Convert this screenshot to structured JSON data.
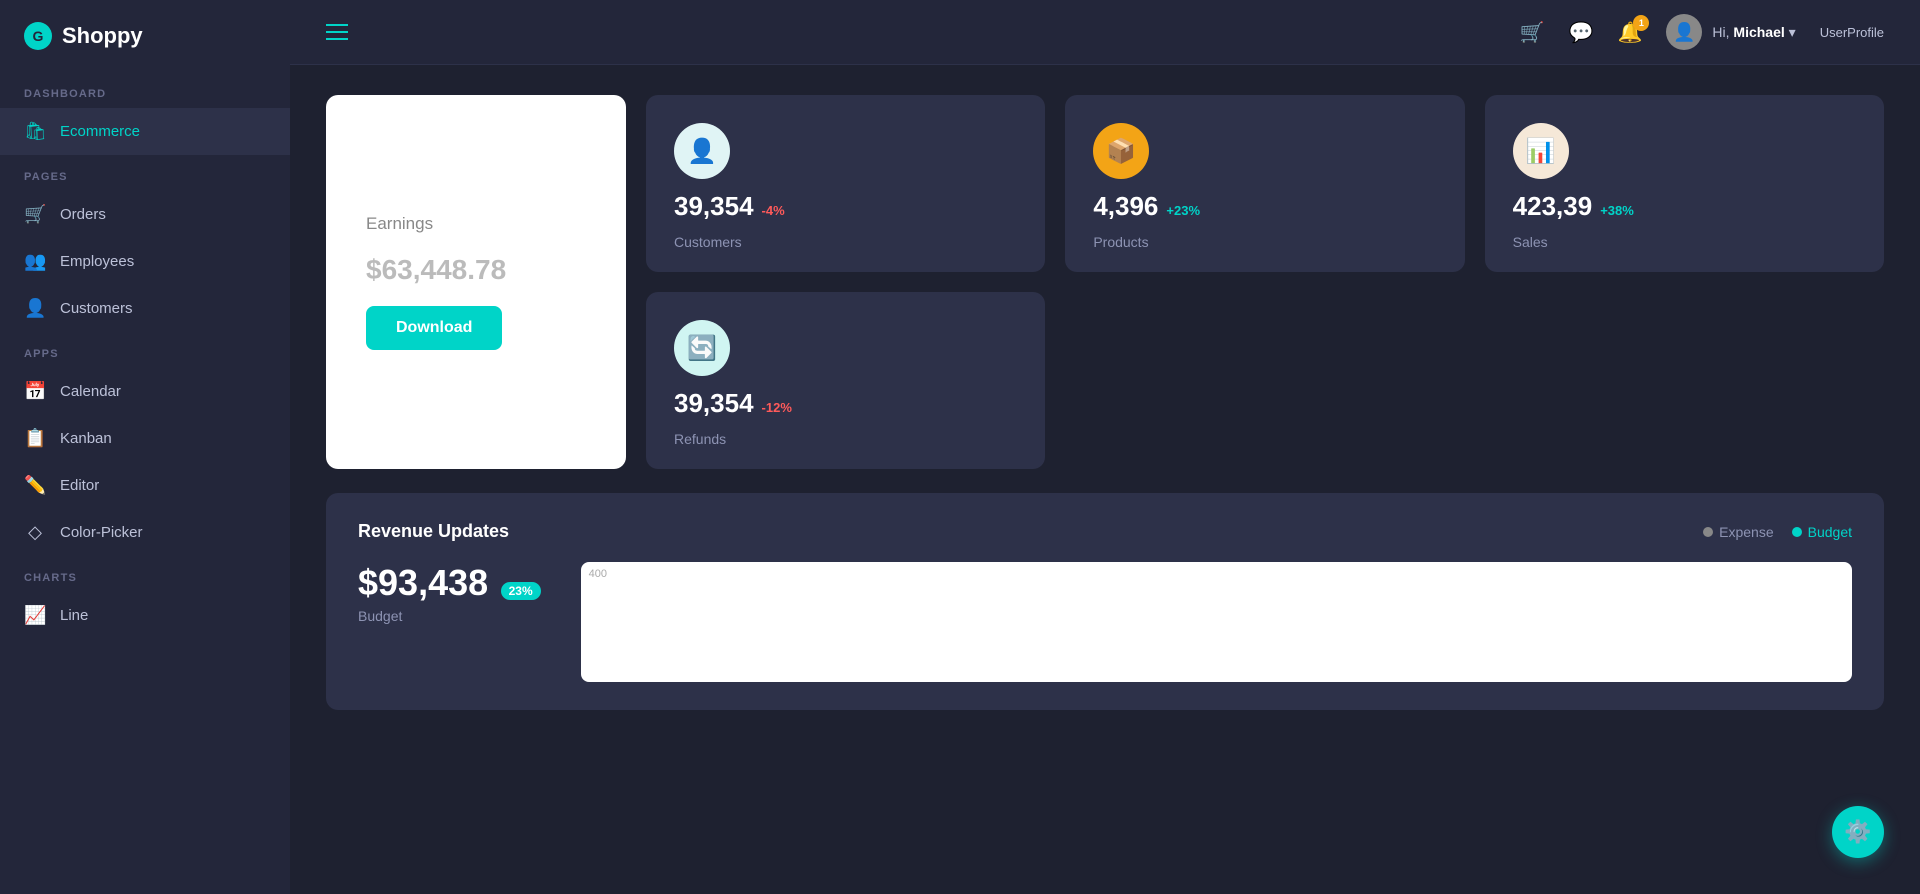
{
  "app": {
    "name": "Shoppy",
    "logo_symbol": "G"
  },
  "sidebar": {
    "sections": [
      {
        "label": "DASHBOARD",
        "items": [
          {
            "id": "ecommerce",
            "label": "Ecommerce",
            "icon": "🛍",
            "active": true
          }
        ]
      },
      {
        "label": "PAGES",
        "items": [
          {
            "id": "orders",
            "label": "Orders",
            "icon": "🛒",
            "active": false
          },
          {
            "id": "employees",
            "label": "Employees",
            "icon": "👥",
            "active": false
          },
          {
            "id": "customers",
            "label": "Customers",
            "icon": "👤",
            "active": false
          }
        ]
      },
      {
        "label": "APPS",
        "items": [
          {
            "id": "calendar",
            "label": "Calendar",
            "icon": "📅",
            "active": false
          },
          {
            "id": "kanban",
            "label": "Kanban",
            "icon": "📋",
            "active": false
          },
          {
            "id": "editor",
            "label": "Editor",
            "icon": "✏️",
            "active": false
          },
          {
            "id": "color-picker",
            "label": "Color-Picker",
            "icon": "◇",
            "active": false
          }
        ]
      },
      {
        "label": "CHARTS",
        "items": [
          {
            "id": "line",
            "label": "Line",
            "icon": "📈",
            "active": false
          }
        ]
      }
    ]
  },
  "topbar": {
    "hamburger_label": "menu",
    "icons": [
      {
        "id": "cart",
        "symbol": "🛒",
        "badge": null
      },
      {
        "id": "chat",
        "symbol": "💬",
        "badge": null
      },
      {
        "id": "bell",
        "symbol": "🔔",
        "badge": "1"
      }
    ],
    "user": {
      "greeting": "Hi,",
      "name": "Michael",
      "profile_link": "UserProfile"
    }
  },
  "earnings_card": {
    "label": "Earnings",
    "value": "$63,448.78",
    "button_label": "Download"
  },
  "stat_cards": [
    {
      "id": "customers",
      "icon": "👤",
      "icon_style": "icon-blue",
      "value": "39,354",
      "change": "-4%",
      "change_type": "negative",
      "label": "Customers"
    },
    {
      "id": "products",
      "icon": "📦",
      "icon_style": "icon-yellow",
      "value": "4,396",
      "change": "+23%",
      "change_type": "positive",
      "label": "Products"
    },
    {
      "id": "sales",
      "icon": "📊",
      "icon_style": "icon-beige",
      "value": "423,39",
      "change": "+38%",
      "change_type": "positive",
      "label": "Sales"
    },
    {
      "id": "refunds",
      "icon": "🔄",
      "icon_style": "icon-teal",
      "value": "39,354",
      "change": "-12%",
      "change_type": "negative",
      "label": "Refunds"
    }
  ],
  "revenue": {
    "title": "Revenue Updates",
    "legend": {
      "expense_label": "Expense",
      "budget_label": "Budget"
    },
    "amount": "$93,438",
    "badge": "23%",
    "sub_label": "Budget",
    "chart_label": "400"
  }
}
